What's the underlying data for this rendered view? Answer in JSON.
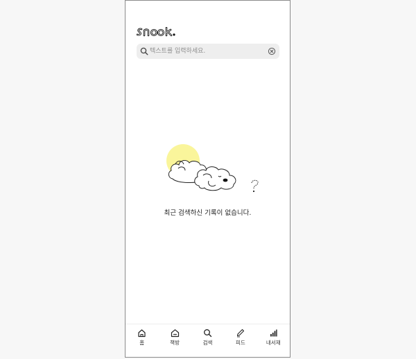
{
  "app": {
    "logo_text": "snook"
  },
  "search": {
    "placeholder": "텍스트를 입력하세요.",
    "value": ""
  },
  "empty_state": {
    "message": "최근 검색하신 기록이 없습니다."
  },
  "colors": {
    "highlight": "#faf59b",
    "search_bg": "#eeeeee",
    "text": "#222222"
  },
  "tabbar": {
    "items": [
      {
        "label": "홈",
        "icon": "home-icon"
      },
      {
        "label": "책방",
        "icon": "bookstore-icon"
      },
      {
        "label": "검색",
        "icon": "search-icon"
      },
      {
        "label": "피드",
        "icon": "pen-icon"
      },
      {
        "label": "내서재",
        "icon": "library-icon"
      }
    ]
  }
}
